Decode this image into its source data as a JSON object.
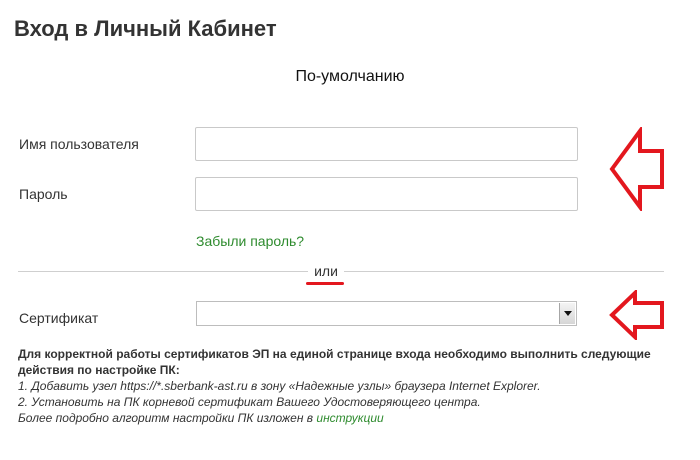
{
  "page_title": "Вход в Личный Кабинет",
  "section_title": "По-умолчанию",
  "form": {
    "username_label": "Имя пользователя",
    "username_value": "",
    "password_label": "Пароль",
    "password_value": "",
    "forgot_password": "Забыли пароль?"
  },
  "separator_text": "или",
  "certificate": {
    "label": "Сертификат",
    "selected_value": ""
  },
  "info": {
    "intro": "Для корректной работы сертификатов ЭП на единой странице входа необходимо выполнить следующие действия по настройке ПК:",
    "step1": "1. Добавить узел https://*.sberbank-ast.ru в зону «Надежные узлы» браузера Internet Explorer.",
    "step2": "2. Установить на ПК корневой сертификат Вашего Удостоверяющего центра.",
    "more_prefix": "Более подробно алгоритм настройки ПК изложен в ",
    "more_link": "инструкции"
  },
  "colors": {
    "accent_red": "#e3171e",
    "link_green": "#2e8b2e",
    "text": "#333333",
    "border": "#c9c9c9"
  },
  "icons": {
    "arrow_top": "left-arrow-icon",
    "arrow_bottom": "left-arrow-icon"
  }
}
